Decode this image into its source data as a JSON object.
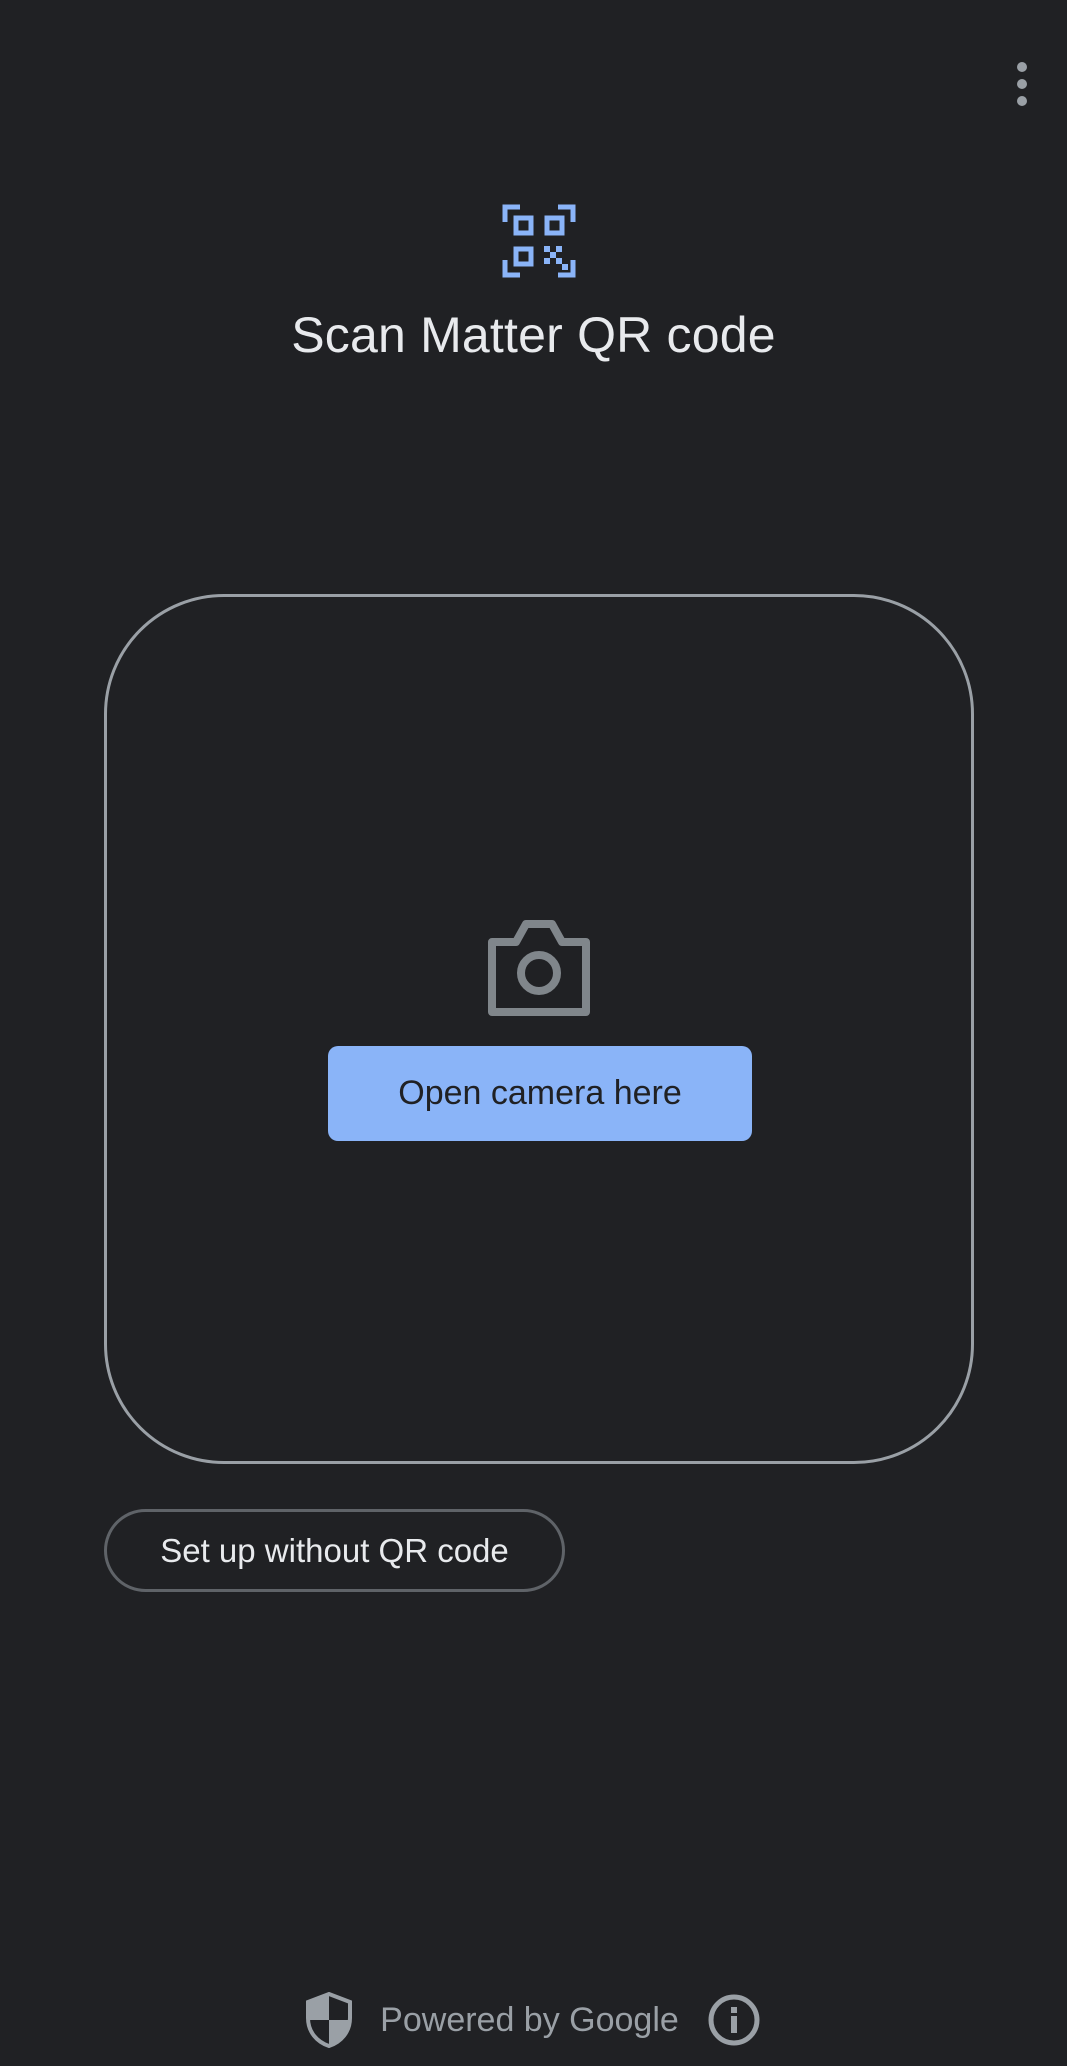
{
  "header": {
    "title": "Scan Matter QR code",
    "icon": "qr-code-scanner-icon",
    "menu_icon": "more-vert-icon"
  },
  "camera": {
    "icon": "camera-icon",
    "open_button_label": "Open camera here"
  },
  "setup_without_qr_label": "Set up without QR code",
  "footer": {
    "text": "Powered by Google",
    "shield_icon": "shield-icon",
    "info_icon": "info-icon"
  },
  "colors": {
    "background": "#202124",
    "accent": "#8ab4f8",
    "text_primary": "#e8eaed",
    "text_secondary": "#9aa0a6",
    "outline": "#9aa0a6"
  }
}
